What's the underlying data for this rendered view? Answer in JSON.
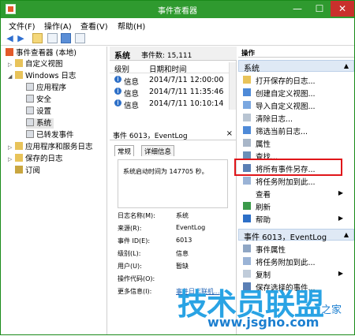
{
  "window": {
    "title": "事件查看器",
    "minimize_glyph": "—",
    "maximize_glyph": "☐",
    "close_glyph": "✕"
  },
  "menu": [
    "文件(F)",
    "操作(A)",
    "查看(V)",
    "帮助(H)"
  ],
  "tree": {
    "root": "事件查看器 (本地)",
    "custom_views": "自定义视图",
    "windows_logs": "Windows 日志",
    "application": "应用程序",
    "security": "安全",
    "setup": "设置",
    "system": "系统",
    "forwarded": "已转发事件",
    "apps_services": "应用程序和服务日志",
    "saved_logs": "保存的日志",
    "subscriptions": "订阅"
  },
  "center": {
    "log_name": "系统",
    "event_count": "事件数: 15,111",
    "col_level": "级别",
    "col_datetime": "日期和时间",
    "rows": [
      {
        "level": "信息",
        "datetime": "2014/7/11 12:00:00"
      },
      {
        "level": "信息",
        "datetime": "2014/7/11 11:35:46"
      },
      {
        "level": "信息",
        "datetime": "2014/7/11 10:10:14"
      }
    ]
  },
  "detail": {
    "title": "事件 6013，EventLog",
    "close": "×",
    "tab_general": "常规",
    "tab_details": "详细信息",
    "description": "系统启动时间为 147705 秒。",
    "fields": [
      {
        "label": "日志名称(M):",
        "value": "系统"
      },
      {
        "label": "来源(R):",
        "value": "EventLog"
      },
      {
        "label": "事件 ID(E):",
        "value": "6013"
      },
      {
        "label": "级别(L):",
        "value": "信息"
      },
      {
        "label": "用户(U):",
        "value": "暂缺"
      },
      {
        "label": "操作代码(O):",
        "value": ""
      },
      {
        "label": "更多信息(I):",
        "value": "事件日志联机..."
      }
    ]
  },
  "actions": {
    "header": "操作",
    "section1": "系统",
    "items1": [
      {
        "label": "打开保存的日志...",
        "icon": "folder-icon"
      },
      {
        "label": "创建自定义视图...",
        "icon": "filter-create-icon"
      },
      {
        "label": "导入自定义视图...",
        "icon": "import-icon"
      },
      {
        "label": "清除日志...",
        "icon": "clear-icon"
      },
      {
        "label": "筛选当前日志...",
        "icon": "filter-icon"
      },
      {
        "label": "属性",
        "icon": "properties-icon"
      },
      {
        "label": "查找...",
        "icon": "find-icon"
      },
      {
        "label": "将所有事件另存...",
        "icon": "save-icon"
      },
      {
        "label": "将任务附加到此...",
        "icon": "task-icon"
      },
      {
        "label": "查看",
        "icon": "view-icon",
        "submenu": true
      },
      {
        "label": "刷新",
        "icon": "refresh-icon"
      },
      {
        "label": "帮助",
        "icon": "help-icon",
        "submenu": true
      }
    ],
    "section2": "事件 6013，EventLog",
    "items2": [
      {
        "label": "事件属性",
        "icon": "event-properties-icon"
      },
      {
        "label": "将任务附加到此...",
        "icon": "task-icon"
      },
      {
        "label": "复制",
        "icon": "copy-icon",
        "submenu": true
      },
      {
        "label": "保存选择的事件...",
        "icon": "save-icon"
      }
    ]
  },
  "watermark": {
    "main": "技术员联盟",
    "url": "www.jsgho.com",
    "suffix": "之家"
  },
  "colors": {
    "title": "#2f9a2f",
    "highlight": "#e0161a",
    "section": "#dfe9f5",
    "watermark": "#29a3e4"
  }
}
